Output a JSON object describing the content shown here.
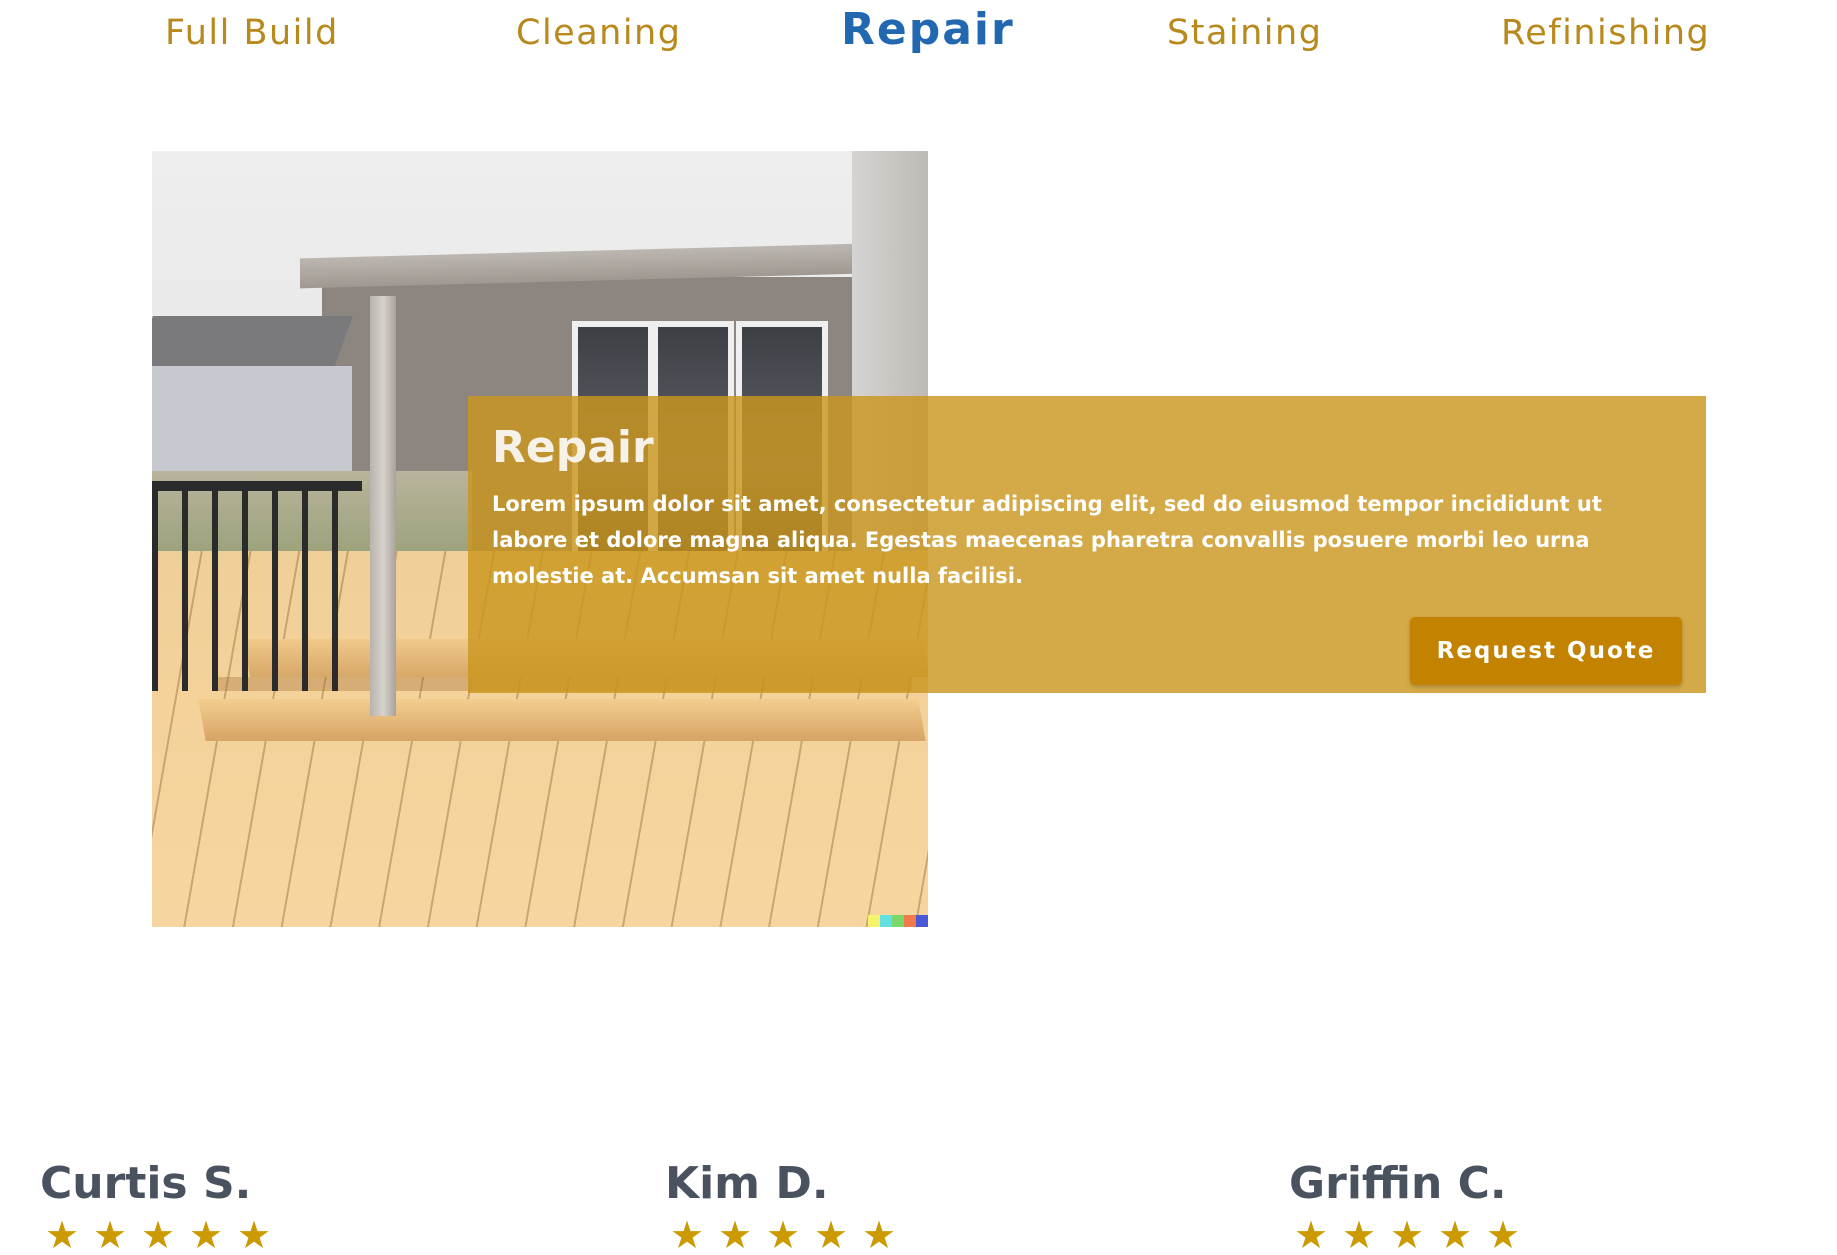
{
  "tabs": [
    {
      "label": "Full Build",
      "active": false
    },
    {
      "label": "Cleaning",
      "active": false
    },
    {
      "label": "Repair",
      "active": true
    },
    {
      "label": "Staining",
      "active": false
    },
    {
      "label": "Refinishing",
      "active": false
    }
  ],
  "feature": {
    "title": "Repair",
    "body": "Lorem ipsum dolor sit amet, consectetur adipiscing elit, sed do eiusmod tempor incididunt ut labore et dolore magna aliqua. Egestas maecenas pharetra convallis posuere morbi leo urna molestie at. Accumsan sit amet nulla facilisi.",
    "button_label": "Request Quote"
  },
  "reviews": [
    {
      "name": "Curtis S.",
      "rating": 5
    },
    {
      "name": "Kim D.",
      "rating": 5
    },
    {
      "name": "Griffin C.",
      "rating": 5
    }
  ],
  "colors": {
    "tab": "#b8891c",
    "tab_active": "#2268b0",
    "card_overlay": "#cb961e",
    "button": "#c38200",
    "star": "#cc9a00",
    "reviewer_name": "#4a5260"
  }
}
